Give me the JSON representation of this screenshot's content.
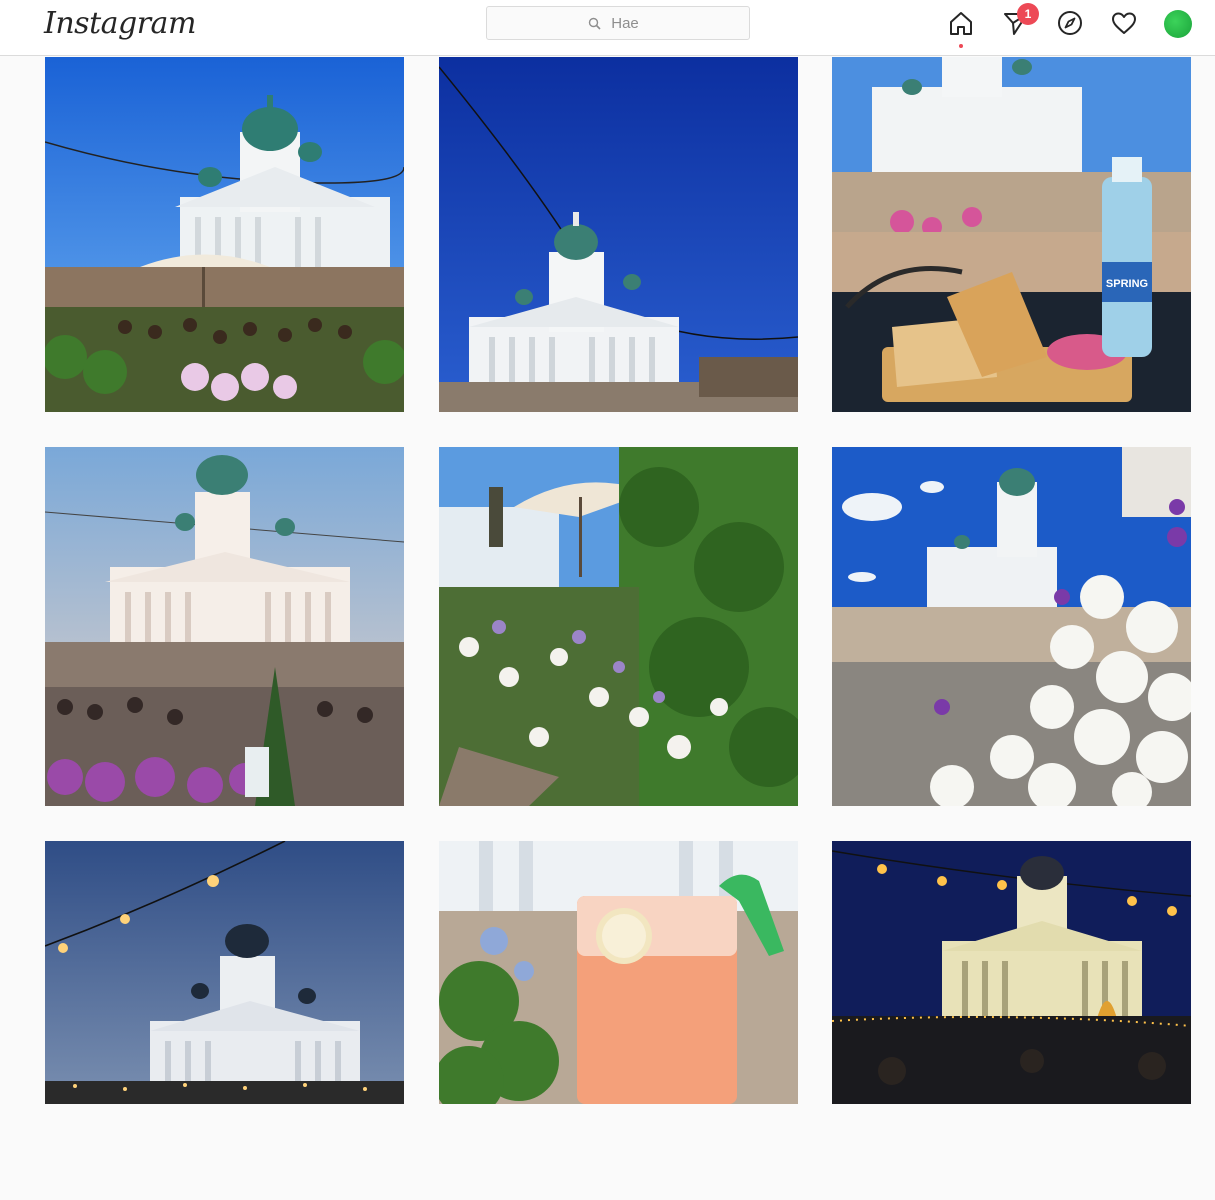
{
  "header": {
    "logo": "Instagram",
    "search_placeholder": "Hae",
    "direct_badge": "1"
  },
  "icons": {
    "home": "home-icon",
    "direct": "direct-message-icon",
    "explore": "compass-icon",
    "activity": "heart-icon",
    "profile": "avatar"
  },
  "colors": {
    "badge": "#ed4956",
    "border": "#dbdbdb",
    "background": "#fafafa",
    "avatar": "#2ec14e"
  },
  "posts": [
    {
      "id": "post-1",
      "scene": "cathedral-terrace-day"
    },
    {
      "id": "post-2",
      "scene": "cathedral-blue-sky-lights"
    },
    {
      "id": "post-3",
      "scene": "sandwich-water-bottle"
    },
    {
      "id": "post-4",
      "scene": "cathedral-dusk-crowd"
    },
    {
      "id": "post-5",
      "scene": "flowers-umbrella"
    },
    {
      "id": "post-6",
      "scene": "white-petunias-cathedral"
    },
    {
      "id": "post-7",
      "scene": "cathedral-evening-lights"
    },
    {
      "id": "post-8",
      "scene": "pink-drink"
    },
    {
      "id": "post-9",
      "scene": "cathedral-night-lights"
    }
  ],
  "bottle_label": "SPRING"
}
